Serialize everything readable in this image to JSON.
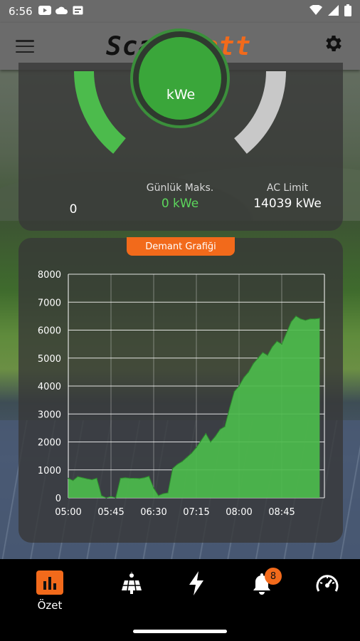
{
  "status_bar": {
    "time": "6:56",
    "icons": [
      "youtube-icon",
      "cloud-icon",
      "calendar-icon"
    ],
    "right_icons": [
      "wifi-icon",
      "signal-icon",
      "battery-icon"
    ]
  },
  "app_bar": {
    "logo_part1": "Scada",
    "logo_part2": "Watt",
    "menu_icon": "hamburger-menu-icon",
    "settings_icon": "gear-icon"
  },
  "gauge": {
    "center_unit": "kWe",
    "left_value": "0",
    "daily_max_label": "Günlük Maks.",
    "daily_max_value": "0 kWe",
    "ac_limit_label": "AC Limit",
    "ac_limit_value": "14039 kWe",
    "colors": {
      "active": "#4cbb4c",
      "inactive": "#c8c8c8",
      "center": "#3aa63a"
    }
  },
  "chart_tag": "Demant Grafiği",
  "chart_data": {
    "type": "area",
    "title": "Demant Grafiği",
    "xlabel": "",
    "ylabel": "",
    "ylim": [
      0,
      8000
    ],
    "yticks": [
      "0",
      "1000",
      "2000",
      "3000",
      "4000",
      "5000",
      "6000",
      "7000",
      "8000"
    ],
    "xticks": [
      "05:00",
      "05:45",
      "06:30",
      "07:15",
      "08:00",
      "08:45"
    ],
    "xlim_minutes": [
      0,
      270
    ],
    "color": "#4cbb4c",
    "grid": true,
    "x": [
      "05:00",
      "05:05",
      "05:10",
      "05:15",
      "05:20",
      "05:25",
      "05:30",
      "05:35",
      "05:40",
      "05:45",
      "05:50",
      "05:55",
      "06:00",
      "06:05",
      "06:10",
      "06:15",
      "06:20",
      "06:25",
      "06:30",
      "06:35",
      "06:40",
      "06:45",
      "06:50",
      "06:55",
      "07:00",
      "07:05",
      "07:10",
      "07:15",
      "07:20",
      "07:25",
      "07:30",
      "07:35",
      "07:40",
      "07:45",
      "07:50",
      "07:55",
      "08:00",
      "08:05",
      "08:10",
      "08:15",
      "08:20",
      "08:25",
      "08:30",
      "08:35",
      "08:40",
      "08:45",
      "08:50",
      "08:55",
      "09:00",
      "09:05",
      "09:10",
      "09:15",
      "09:20",
      "09:25"
    ],
    "values": [
      700,
      620,
      760,
      720,
      680,
      650,
      700,
      80,
      0,
      50,
      0,
      700,
      720,
      700,
      700,
      690,
      720,
      770,
      350,
      80,
      150,
      180,
      1050,
      1200,
      1300,
      1450,
      1600,
      1800,
      2050,
      2300,
      2000,
      2200,
      2450,
      2550,
      3200,
      3800,
      4000,
      4300,
      4500,
      4800,
      5000,
      5200,
      5100,
      5400,
      5600,
      5500,
      5900,
      6300,
      6500,
      6400,
      6350,
      6400,
      6400,
      6420
    ]
  },
  "bottom_nav": {
    "items": [
      {
        "label": "Özet",
        "icon": "bar-chart-icon",
        "active": true
      },
      {
        "label": "",
        "icon": "solar-panel-icon"
      },
      {
        "label": "",
        "icon": "lightning-icon"
      },
      {
        "label": "",
        "icon": "bell-icon",
        "badge": "8"
      },
      {
        "label": "",
        "icon": "speedometer-icon"
      }
    ]
  }
}
